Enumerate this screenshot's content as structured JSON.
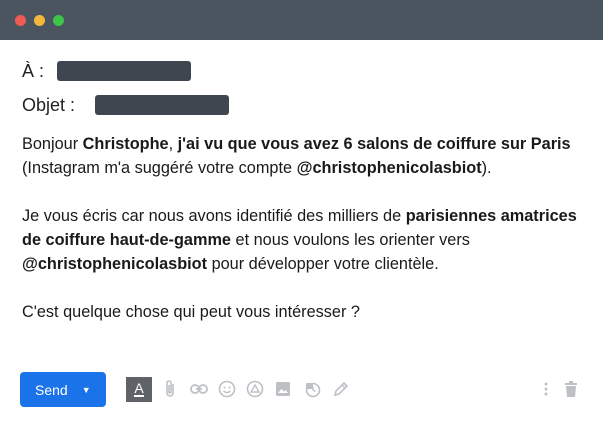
{
  "window": {
    "controls": [
      "close",
      "minimize",
      "maximize"
    ]
  },
  "fields": {
    "to_label": "À :",
    "subject_label": "Objet :"
  },
  "message": {
    "p1": {
      "s1": "Bonjour ",
      "s2": "Christophe",
      "s3": ", ",
      "s4": "j'ai vu que vous avez 6 salons de coiffure sur Paris",
      "s5": " (Instagram m'a suggéré votre compte ",
      "s6": "@christophenicolasbiot",
      "s7": ")."
    },
    "p2": {
      "s1": "Je vous écris car nous avons identifié des milliers de ",
      "s2": "parisiennes amatrices de coiffure haut-de-gamme",
      "s3": " et nous voulons les orienter vers ",
      "s4": "@christophenicolasbiot",
      "s5": " pour développer votre clientèle."
    },
    "p3": "C'est quelque chose qui peut vous intéresser ?"
  },
  "toolbar": {
    "send_label": "Send",
    "icons": [
      "format-text-icon",
      "attach-icon",
      "link-icon",
      "emoji-icon",
      "drive-icon",
      "photo-icon",
      "confidential-icon",
      "signature-icon",
      "more-options-icon",
      "delete-icon"
    ]
  },
  "colors": {
    "send_button": "#1a73e8",
    "titlebar": "#4a5560",
    "redaction": "#3e4750"
  }
}
